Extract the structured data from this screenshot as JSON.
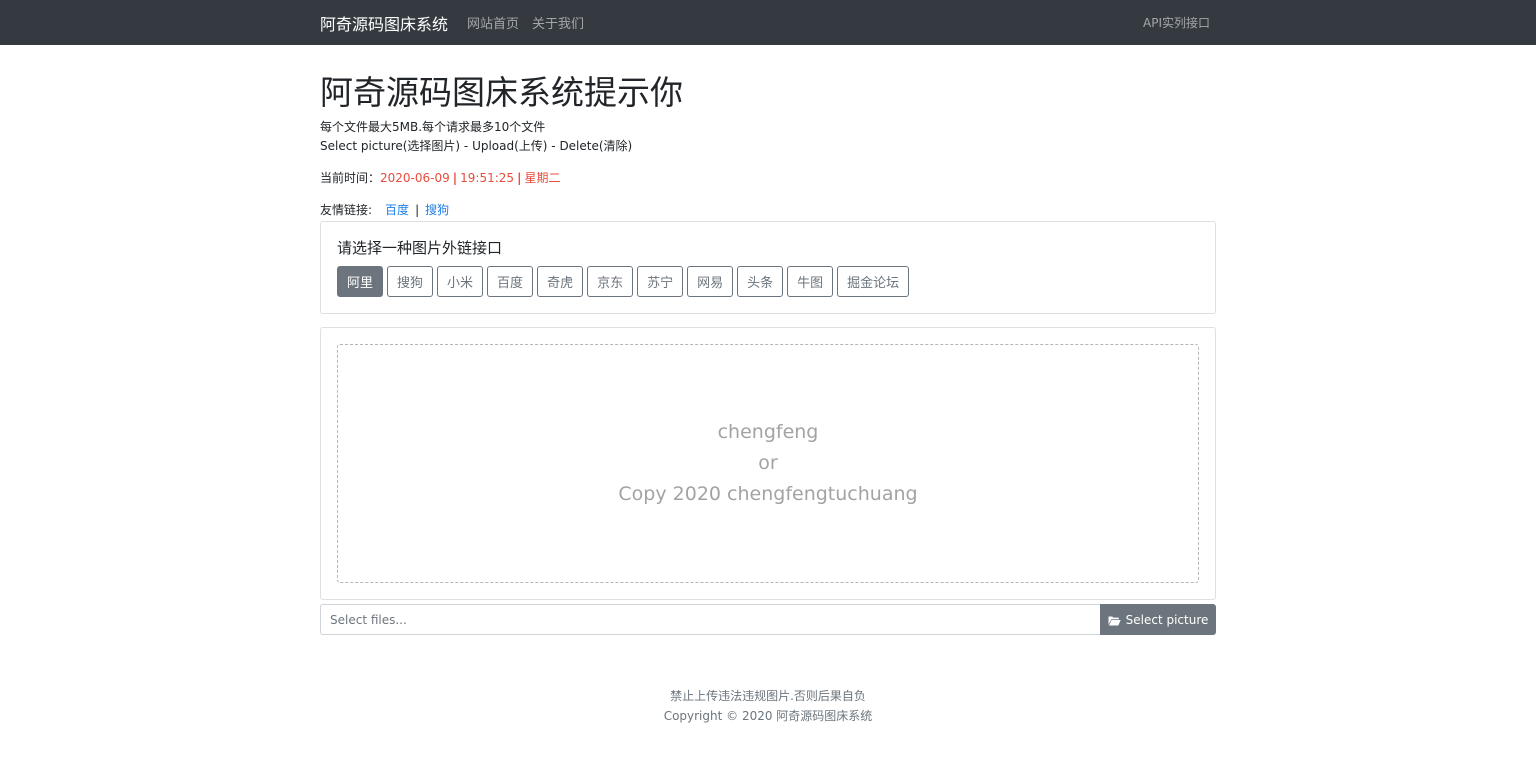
{
  "navbar": {
    "brand": "阿奇源码图床系统",
    "links": [
      "网站首页",
      "关于我们"
    ],
    "right_link": "API实列接口"
  },
  "hero": {
    "title": "阿奇源码图床系统提示你",
    "line1": "每个文件最大5MB.每个请求最多10个文件",
    "line2": "Select picture(选择图片) - Upload(上传) - Delete(清除)"
  },
  "time": {
    "label": "当前时间：",
    "date": "2020-06-09",
    "clock": "19:51:25",
    "weekday": "星期二",
    "separator": "|"
  },
  "friend_links": {
    "label": "友情链接:",
    "items": [
      "百度",
      "搜狗"
    ],
    "divider": "|"
  },
  "api_card": {
    "title": "请选择一种图片外链接口",
    "buttons": [
      "阿里",
      "搜狗",
      "小米",
      "百度",
      "奇虎",
      "京东",
      "苏宁",
      "网易",
      "头条",
      "牛图",
      "掘金论坛"
    ],
    "active": "阿里"
  },
  "dropzone": {
    "line1": "chengfeng",
    "line2": "or",
    "line3": "Copy 2020 chengfengtuchuang"
  },
  "file_input": {
    "placeholder": "Select files...",
    "button_label": "Select picture",
    "button_icon": "folder-open-icon"
  },
  "footer": {
    "line1": "禁止上传违法违规图片.否则后果自负",
    "line2": "Copyright © 2020 阿奇源码图床系统"
  },
  "colors": {
    "navbar": "#343a40",
    "accent_red": "#e74c3c",
    "link_blue": "#1e7ee8",
    "secondary": "#6c757d"
  }
}
